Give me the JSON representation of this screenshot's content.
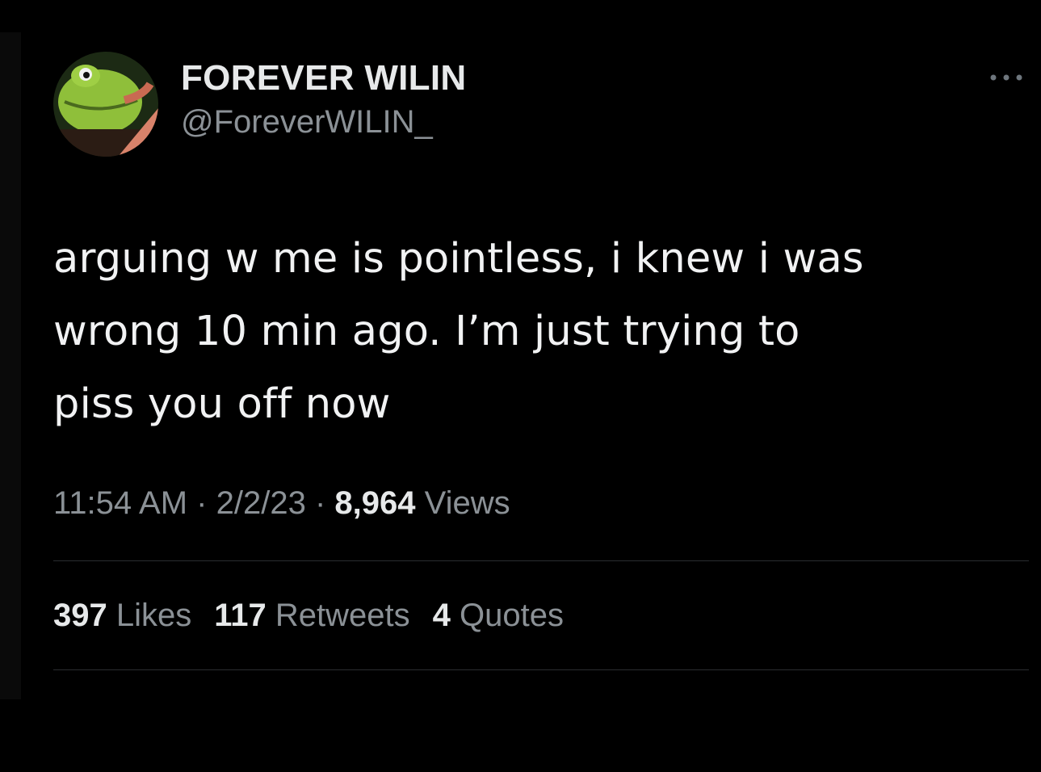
{
  "tweet": {
    "display_name": "FOREVER WILIN",
    "handle": "@ForeverWILIN_",
    "avatar_icon": "frog-avatar-icon",
    "more_icon": "more-options-icon",
    "text_lines": [
      "arguing w me is pointless, i knew i was",
      "wrong 10 min ago. I’m just trying to",
      "piss you off now"
    ],
    "time": "11:54 AM",
    "date": "2/2/23",
    "separator": "·",
    "views_count": "8,964",
    "views_label": "Views"
  },
  "stats": {
    "likes_count": "397",
    "likes_label": "Likes",
    "retweets_count": "117",
    "retweets_label": "Retweets",
    "quotes_count": "4",
    "quotes_label": "Quotes"
  },
  "colors": {
    "background": "#000000",
    "primary_text": "#e7e9ea",
    "secondary_text": "#8b9196",
    "divider": "#2a2d30"
  }
}
